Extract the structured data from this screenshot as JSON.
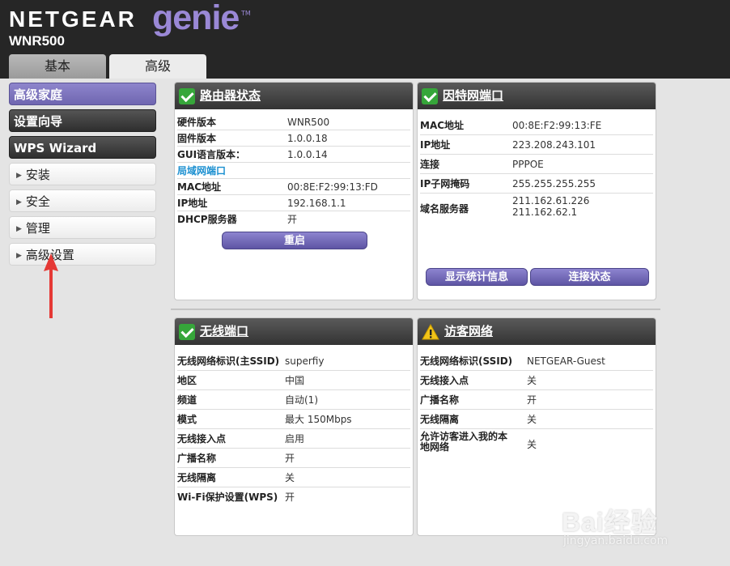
{
  "header": {
    "brand": "NETGEAR",
    "genie": "genie",
    "tm": "TM",
    "model": "WNR500",
    "tabs": [
      {
        "label": "基本"
      },
      {
        "label": "高级"
      }
    ]
  },
  "sidebar": {
    "items": [
      {
        "label": "高级家庭"
      },
      {
        "label": "设置向导"
      },
      {
        "label": "WPS Wizard"
      },
      {
        "label": "安装"
      },
      {
        "label": "安全"
      },
      {
        "label": "管理"
      },
      {
        "label": "高级设置"
      }
    ]
  },
  "router_status": {
    "title": "路由器状态",
    "rows": [
      {
        "k": "硬件版本",
        "v": "WNR500"
      },
      {
        "k": "固件版本",
        "v": "1.0.0.18"
      },
      {
        "k": "GUI语言版本：",
        "v": "1.0.0.14"
      }
    ],
    "lan_section": "局域网端口",
    "lan_rows": [
      {
        "k": "MAC地址",
        "v": "00:8E:F2:99:13:FD"
      },
      {
        "k": "IP地址",
        "v": "192.168.1.1"
      },
      {
        "k": "DHCP服务器",
        "v": "开"
      }
    ],
    "reboot_label": "重启"
  },
  "internet_port": {
    "title": "因特网端口",
    "rows": [
      {
        "k": "MAC地址",
        "v": "00:8E:F2:99:13:FE"
      },
      {
        "k": "IP地址",
        "v": "223.208.243.101"
      },
      {
        "k": "连接",
        "v": "PPPOE"
      },
      {
        "k": "IP子网掩码",
        "v": "255.255.255.255"
      }
    ],
    "dns_label": "域名服务器",
    "dns_values": [
      "211.162.61.226",
      "211.162.62.1"
    ],
    "stats_label": "显示统计信息",
    "conn_label": "连接状态"
  },
  "wireless_port": {
    "title": "无线端口",
    "rows": [
      {
        "k": "无线网络标识(主SSID)",
        "v": "superfiy"
      },
      {
        "k": "地区",
        "v": "中国"
      },
      {
        "k": "频道",
        "v": "自动(1)"
      },
      {
        "k": "模式",
        "v": "最大 150Mbps"
      },
      {
        "k": "无线接入点",
        "v": "启用"
      },
      {
        "k": "广播名称",
        "v": "开"
      },
      {
        "k": "无线隔离",
        "v": "关"
      },
      {
        "k": "Wi-Fi保护设置(WPS)",
        "v": "开"
      }
    ]
  },
  "guest_network": {
    "title": "访客网络",
    "rows": [
      {
        "k": "无线网络标识(SSID)",
        "v": "NETGEAR-Guest"
      },
      {
        "k": "无线接入点",
        "v": "关"
      },
      {
        "k": "广播名称",
        "v": "开"
      },
      {
        "k": "无线隔离",
        "v": "关"
      }
    ],
    "allow_label_1": "允许访客进入我的本",
    "allow_label_2": "地网络",
    "allow_value": "关"
  },
  "watermark": {
    "text": "Bai经验",
    "url": "jingyan.baidu.com"
  },
  "colors": {
    "header_bg": "#262626",
    "genie_purple": "#9a88d6",
    "button_purple": "#6f66b0",
    "check_green": "#36a63a",
    "section_blue": "#1a8fd0",
    "arrow_red": "#e53935"
  }
}
